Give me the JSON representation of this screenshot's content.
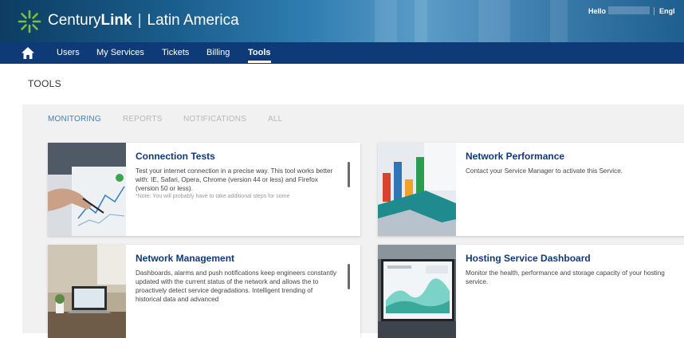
{
  "header": {
    "brand_part1": "Century",
    "brand_part2": "Link",
    "separator": "|",
    "region": "Latin America",
    "hello": "Hello",
    "language": "Engl"
  },
  "nav": {
    "home_icon": "home-icon",
    "items": [
      "Users",
      "My Services",
      "Tickets",
      "Billing",
      "Tools"
    ],
    "active": "Tools"
  },
  "page_title": "TOOLS",
  "tabs": [
    "MONITORING",
    "REPORTS",
    "NOTIFICATIONS",
    "ALL"
  ],
  "active_tab": "MONITORING",
  "cards": [
    {
      "title": "Connection Tests",
      "body": "Test your internet connection in a precise way. This tool works better with: IE, Safari, Opera, Chrome (version 44 or less) and Firefox (version 50 or less).",
      "note": "*Note: You will probably have to take additional steps for some"
    },
    {
      "title": "Network Performance",
      "body": "Contact your Service Manager to activate this Service."
    },
    {
      "title": "Network Management",
      "body": "Dashboards, alarms and push notifications keep engineers constantly updated with the current status of the network and allows the to proactively detect service degradations. Intelligent trending of historical data and advanced"
    },
    {
      "title": "Hosting Service Dashboard",
      "body": "Monitor the health, performance and storage capacity of your hosting service."
    }
  ],
  "colors": {
    "nav_bg": "#0e3a77",
    "accent": "#3b82c4",
    "logo_green": "#7cc043",
    "card_title": "#0e3a77"
  }
}
